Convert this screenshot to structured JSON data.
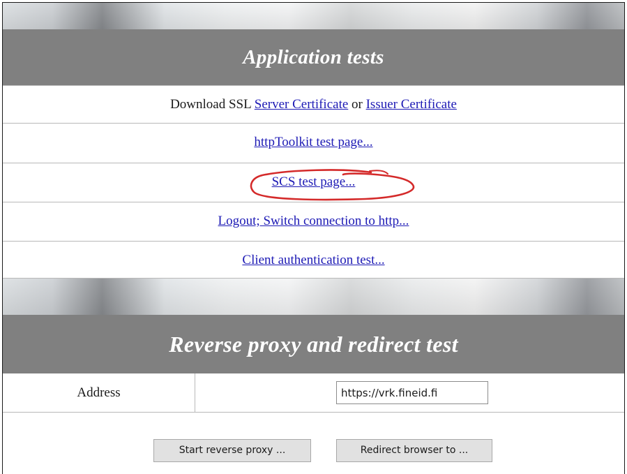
{
  "application_tests": {
    "title": "Application tests",
    "download_row": {
      "prefix": "Download SSL ",
      "server_cert_link": "Server Certificate",
      "connector": " or ",
      "issuer_cert_link": "Issuer Certificate"
    },
    "links": {
      "http_toolkit": "httpToolkit test page...",
      "scs_test": "SCS test page...",
      "logout": "Logout; Switch connection to http...",
      "client_auth": "Client authentication test..."
    }
  },
  "reverse_proxy": {
    "title": "Reverse proxy and redirect test",
    "address_label": "Address",
    "address_value": "https://vrk.fineid.fi",
    "start_button": "Start reverse proxy ...",
    "redirect_button": "Redirect browser to ..."
  },
  "colors": {
    "header_bg": "#808080",
    "link": "#1d1ab5",
    "annotation": "#d42a2a"
  },
  "icons": {
    "annotation": "red-hand-drawn-circle"
  }
}
